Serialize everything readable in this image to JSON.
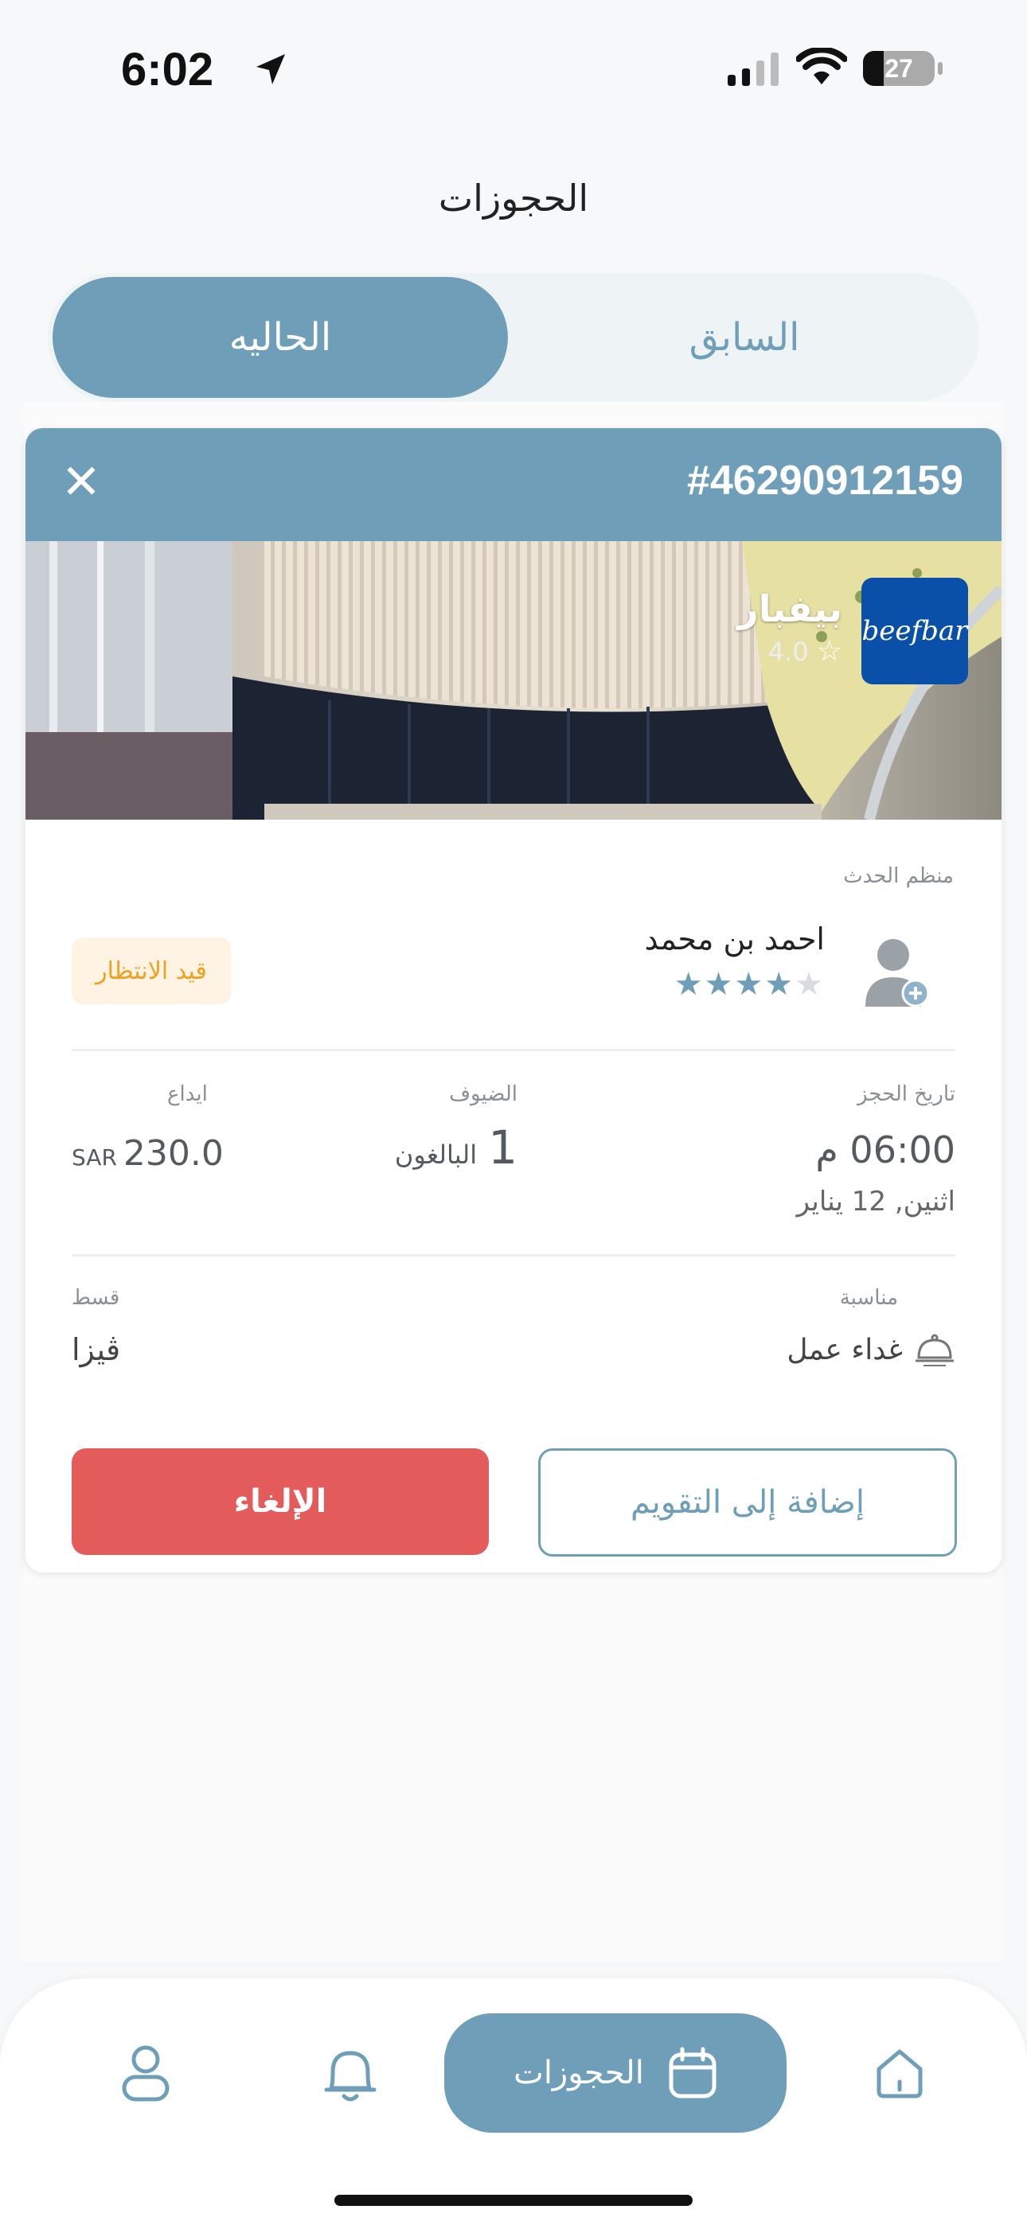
{
  "status_bar": {
    "time": "6:02",
    "battery": "27"
  },
  "header": {
    "title": "الحجوزات"
  },
  "tabs": [
    {
      "label": "الحاليه",
      "active": true
    },
    {
      "label": "السابق",
      "active": false
    }
  ],
  "booking": {
    "number": "#46290912159",
    "restaurant": {
      "name": "بيفبار",
      "rating": "4.0",
      "logo_text": "beefbar"
    },
    "organizer_label": "منظم الحدث",
    "organizer_name": "احمد بن محمد",
    "organizer_stars": 4,
    "status": "قيد الانتظار",
    "date_label": "تاريخ الحجز",
    "time": "06:00 م",
    "day": "اثنين, 12 يناير",
    "guests_label": "الضيوف",
    "guests_count": "1",
    "guests_unit": "البالغون",
    "deposit_label": "ايداع",
    "deposit_amount": "230.0",
    "currency": "SAR",
    "occasion_label": "مناسبة",
    "occasion": "غداء عمل",
    "payment_label": "قسط",
    "payment": "ڤيزا",
    "cancel_label": "الإلغاء",
    "calendar_label": "إضافة إلى التقويم"
  },
  "bottom_nav": {
    "bookings_label": "الحجوزات"
  },
  "colors": {
    "primary": "#6f9fb8",
    "danger": "#e45b5c",
    "pending_bg": "#fff3e3",
    "pending_text": "#f0a020"
  }
}
